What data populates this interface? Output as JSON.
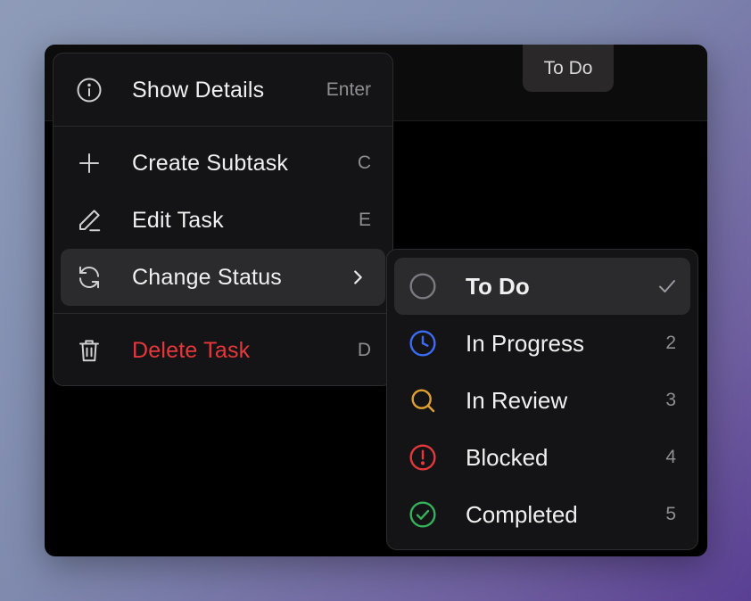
{
  "status_chip": {
    "label": "To Do"
  },
  "menu": {
    "items": [
      {
        "label": "Show Details",
        "shortcut": "Enter",
        "icon": "info-icon"
      },
      {
        "label": "Create Subtask",
        "shortcut": "C",
        "icon": "plus-icon"
      },
      {
        "label": "Edit Task",
        "shortcut": "E",
        "icon": "pencil-icon"
      },
      {
        "label": "Change Status",
        "icon": "refresh-icon",
        "has_submenu": true,
        "active": true
      },
      {
        "label": "Delete Task",
        "shortcut": "D",
        "icon": "trash-icon",
        "danger": true
      }
    ]
  },
  "status_submenu": {
    "items": [
      {
        "label": "To Do",
        "shortcut": "",
        "icon": "circle-icon",
        "selected": true,
        "color": "#7a7a80"
      },
      {
        "label": "In Progress",
        "shortcut": "2",
        "icon": "clock-icon",
        "color": "#3b6cf6"
      },
      {
        "label": "In Review",
        "shortcut": "3",
        "icon": "search-icon",
        "color": "#e0a030"
      },
      {
        "label": "Blocked",
        "shortcut": "4",
        "icon": "alert-circle-icon",
        "color": "#e5383b"
      },
      {
        "label": "Completed",
        "shortcut": "5",
        "icon": "check-circle-icon",
        "color": "#34b35a"
      }
    ]
  },
  "colors": {
    "danger": "#e5383b",
    "background": "#000000",
    "menu_bg": "#141416"
  }
}
